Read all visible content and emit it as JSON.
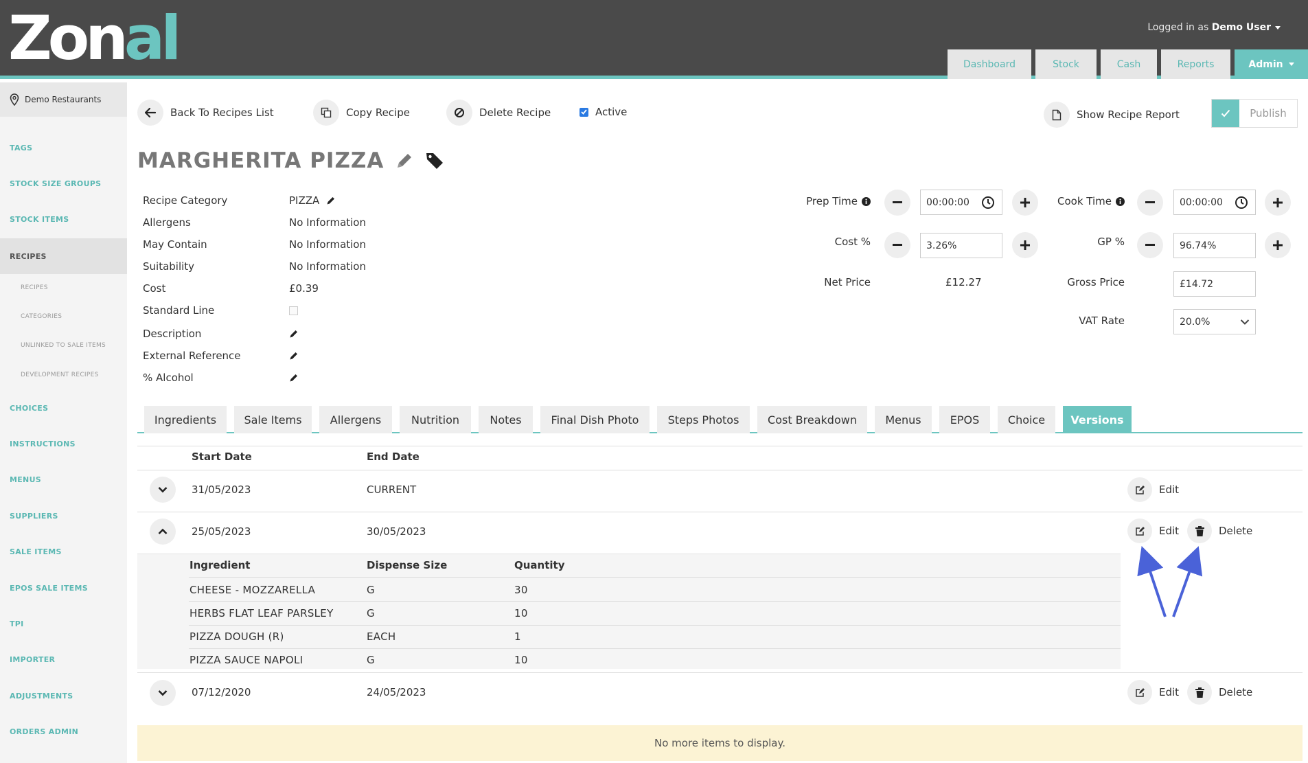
{
  "header": {
    "logo_a": "Zon",
    "logo_b": "al",
    "user_prefix": "Logged in as",
    "user_name": "Demo User",
    "nav": [
      {
        "label": "Dashboard"
      },
      {
        "label": "Stock"
      },
      {
        "label": "Cash"
      },
      {
        "label": "Reports"
      },
      {
        "label": "Admin"
      }
    ],
    "accent_color": "#6cc5c0"
  },
  "sidebar": {
    "location": "Demo Restaurants",
    "items": [
      {
        "label": "TAGS"
      },
      {
        "label": "STOCK SIZE GROUPS"
      },
      {
        "label": "STOCK ITEMS"
      },
      {
        "label": "RECIPES"
      },
      {
        "label": "CHOICES"
      },
      {
        "label": "INSTRUCTIONS"
      },
      {
        "label": "MENUS"
      },
      {
        "label": "SUPPLIERS"
      },
      {
        "label": "SALE ITEMS"
      },
      {
        "label": "EPOS SALE ITEMS"
      },
      {
        "label": "TPI"
      },
      {
        "label": "IMPORTER"
      },
      {
        "label": "ADJUSTMENTS"
      },
      {
        "label": "ORDERS ADMIN"
      }
    ],
    "sub_items": [
      {
        "label": "RECIPES"
      },
      {
        "label": "CATEGORIES"
      },
      {
        "label": "UNLINKED TO SALE ITEMS"
      },
      {
        "label": "DEVELOPMENT RECIPES"
      }
    ]
  },
  "toolbar": {
    "back": "Back To Recipes List",
    "copy": "Copy Recipe",
    "delete": "Delete Recipe",
    "active": "Active",
    "report": "Show Recipe Report",
    "publish": "Publish"
  },
  "recipe": {
    "title": "MARGHERITA PIZZA",
    "details": [
      {
        "label": "Recipe Category",
        "value": "PIZZA"
      },
      {
        "label": "Allergens",
        "value": "No Information"
      },
      {
        "label": "May Contain",
        "value": "No Information"
      },
      {
        "label": "Suitability",
        "value": "No Information"
      },
      {
        "label": "Cost",
        "value": "£0.39"
      },
      {
        "label": "Standard Line",
        "value": ""
      },
      {
        "label": "Description",
        "value": ""
      },
      {
        "label": "External Reference",
        "value": ""
      },
      {
        "label": "% Alcohol",
        "value": ""
      }
    ]
  },
  "form": {
    "prep_time_label": "Prep Time",
    "prep_time": "00:00:00",
    "cook_time_label": "Cook Time",
    "cook_time": "00:00:00",
    "cost_pct_label": "Cost %",
    "cost_pct": "3.26%",
    "gp_pct_label": "GP %",
    "gp_pct": "96.74%",
    "net_price_label": "Net Price",
    "net_price": "£12.27",
    "gross_price_label": "Gross Price",
    "gross_price": "£14.72",
    "vat_label": "VAT Rate",
    "vat": "20.0%"
  },
  "tabs": [
    {
      "label": "Ingredients"
    },
    {
      "label": "Sale Items"
    },
    {
      "label": "Allergens"
    },
    {
      "label": "Nutrition"
    },
    {
      "label": "Notes"
    },
    {
      "label": "Final Dish Photo"
    },
    {
      "label": "Steps Photos"
    },
    {
      "label": "Cost Breakdown"
    },
    {
      "label": "Menus"
    },
    {
      "label": "EPOS"
    },
    {
      "label": "Choice"
    },
    {
      "label": "Versions"
    }
  ],
  "versions": {
    "col_start": "Start Date",
    "col_end": "End Date",
    "edit": "Edit",
    "delete": "Delete",
    "rows": [
      {
        "start": "31/05/2023",
        "end": "CURRENT"
      },
      {
        "start": "25/05/2023",
        "end": "30/05/2023"
      },
      {
        "start": "07/12/2020",
        "end": "24/05/2023"
      }
    ],
    "sub_cols": {
      "ingredient": "Ingredient",
      "dispense": "Dispense Size",
      "quantity": "Quantity"
    },
    "sub_rows": [
      {
        "ingredient": "CHEESE - MOZZARELLA",
        "dispense": "G",
        "quantity": "30"
      },
      {
        "ingredient": "HERBS FLAT LEAF PARSLEY",
        "dispense": "G",
        "quantity": "10"
      },
      {
        "ingredient": "PIZZA DOUGH (R)",
        "dispense": "EACH",
        "quantity": "1"
      },
      {
        "ingredient": "PIZZA SAUCE NAPOLI",
        "dispense": "G",
        "quantity": "10"
      }
    ],
    "no_more": "No more items to display."
  }
}
